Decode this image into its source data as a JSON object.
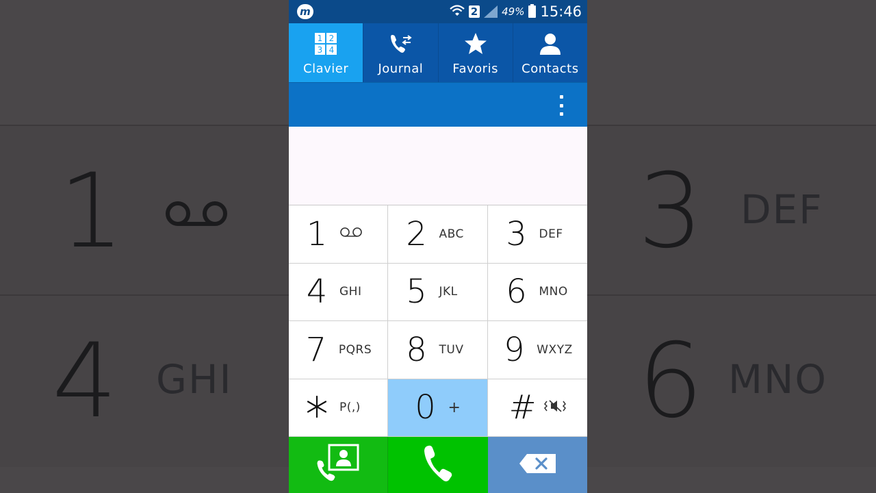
{
  "status_bar": {
    "app_logo": "m",
    "sim_slot": "2",
    "battery": "49%",
    "time": "15:46"
  },
  "tabs": [
    {
      "label": "Clavier",
      "icon": "dialpad-icon",
      "active": true
    },
    {
      "label": "Journal",
      "icon": "call-log-icon",
      "active": false
    },
    {
      "label": "Favoris",
      "icon": "star-icon",
      "active": false
    },
    {
      "label": "Contacts",
      "icon": "person-icon",
      "active": false
    }
  ],
  "dialpad_icon_digits": [
    "1",
    "2",
    "3",
    "4"
  ],
  "number_display": "",
  "keys": [
    {
      "digit": "1",
      "letters": ""
    },
    {
      "digit": "2",
      "letters": "ABC"
    },
    {
      "digit": "3",
      "letters": "DEF"
    },
    {
      "digit": "4",
      "letters": "GHI"
    },
    {
      "digit": "5",
      "letters": "JKL"
    },
    {
      "digit": "6",
      "letters": "MNO"
    },
    {
      "digit": "7",
      "letters": "PQRS"
    },
    {
      "digit": "8",
      "letters": "TUV"
    },
    {
      "digit": "9",
      "letters": "WXYZ"
    },
    {
      "digit": "*",
      "letters": "P(,)"
    },
    {
      "digit": "0",
      "letters": "+"
    },
    {
      "digit": "#",
      "letters": ""
    }
  ],
  "background_echo": {
    "left_top": {
      "digit": "1"
    },
    "left_bottom": {
      "digit": "4",
      "letters": "GHI"
    },
    "right_top": {
      "digit": "3",
      "letters": "DEF"
    },
    "right_bottom": {
      "digit": "6",
      "letters": "MNO"
    }
  },
  "colors": {
    "status_bar": "#0b4a8a",
    "tab_bar": "#0b56a7",
    "tab_active": "#19a2f0",
    "action_bar": "#0c72c6",
    "key_zero_highlight": "#8fccfb",
    "call_green": "#00c200",
    "delete_blue": "#5a8fc9"
  }
}
